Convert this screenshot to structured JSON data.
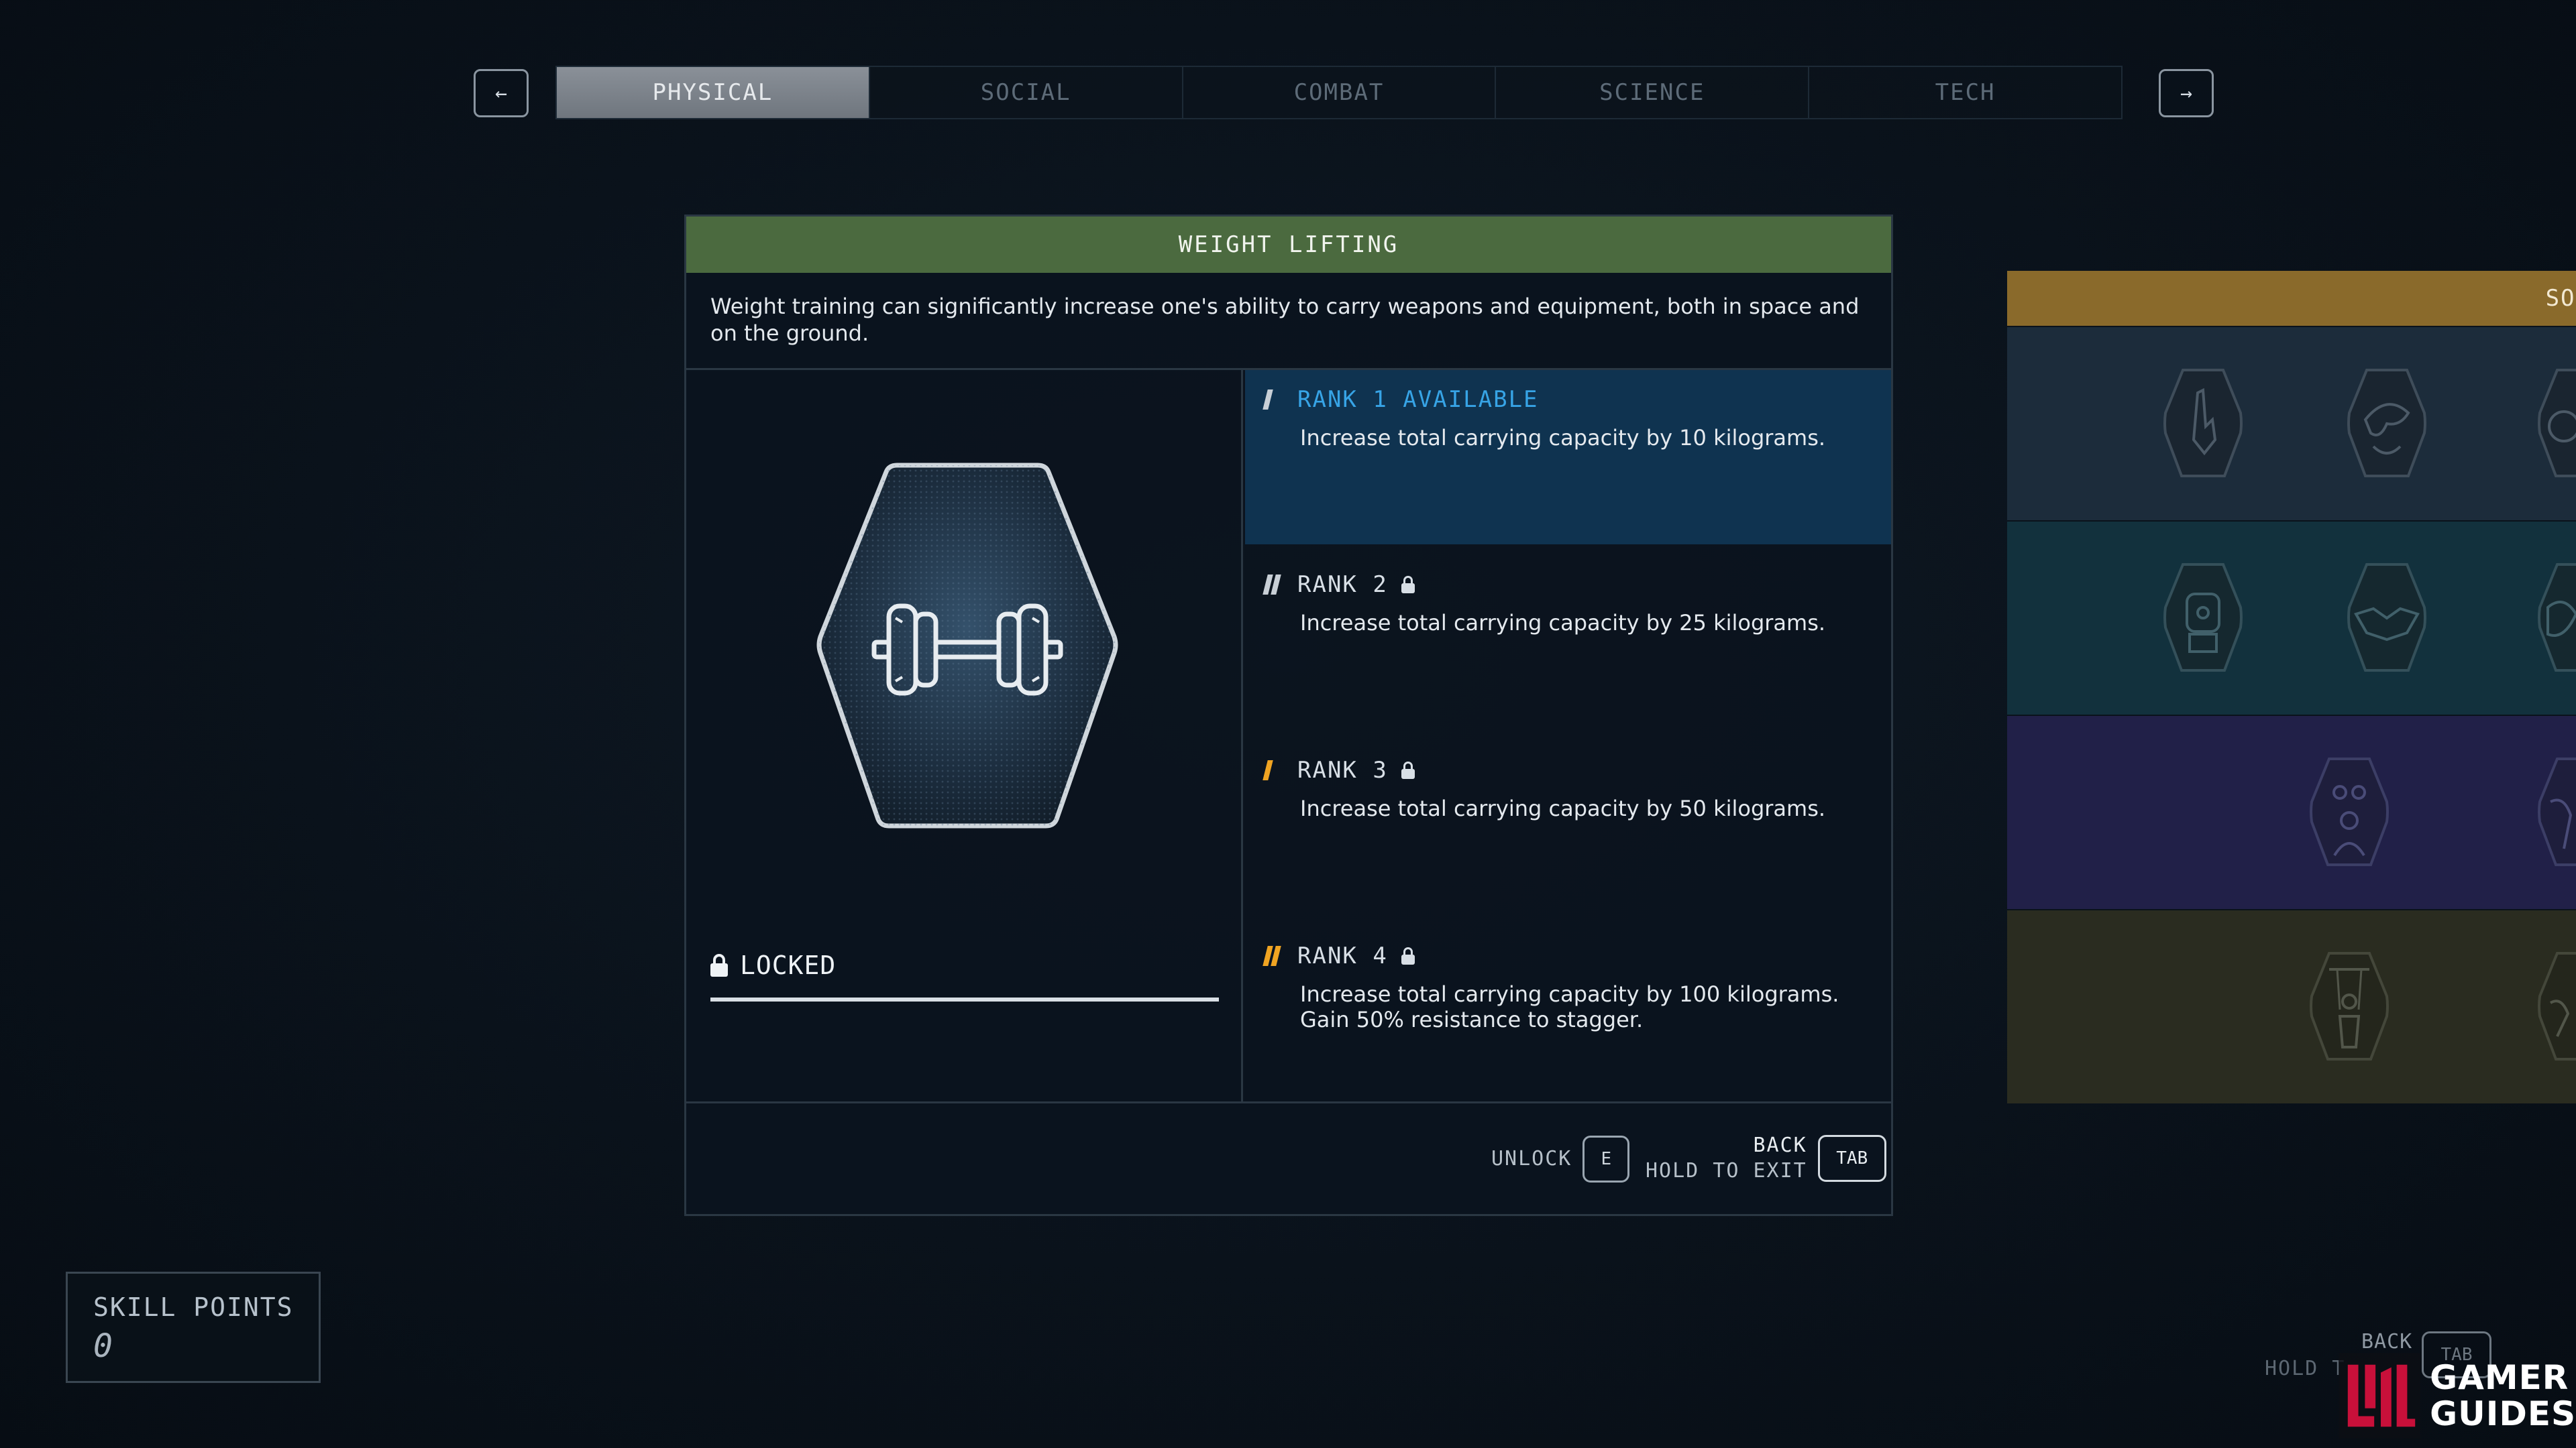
{
  "tabs": [
    {
      "label": "PHYSICAL",
      "active": true
    },
    {
      "label": "SOCIAL",
      "active": false
    },
    {
      "label": "COMBAT",
      "active": false
    },
    {
      "label": "SCIENCE",
      "active": false
    },
    {
      "label": "TECH",
      "active": false
    }
  ],
  "nav": {
    "prev_icon": "arrow-left-icon",
    "prev_glyph": "←",
    "next_icon": "arrow-right-icon",
    "next_glyph": "→"
  },
  "skill": {
    "title": "WEIGHT LIFTING",
    "description": "Weight training can significantly increase one's ability to carry weapons and equipment, both in space and on the ground.",
    "icon": "dumbbell-icon",
    "status": "LOCKED",
    "progress_fraction": 1.0
  },
  "ranks": [
    {
      "label": "RANK 1 AVAILABLE",
      "text": "Increase total carrying capacity by 10 kilograms.",
      "available": true,
      "locked": false,
      "marks": 1,
      "mark_color": "#c8cfd6"
    },
    {
      "label": "RANK 2",
      "text": "Increase total carrying capacity by 25 kilograms.",
      "available": false,
      "locked": true,
      "marks": 2,
      "mark_color": "#c8cfd6"
    },
    {
      "label": "RANK 3",
      "text": "Increase total carrying capacity by 50 kilograms.",
      "available": false,
      "locked": true,
      "marks": 1,
      "mark_color": "#f0a422"
    },
    {
      "label": "RANK 4",
      "text": "Increase total carrying capacity by 100 kilograms. Gain 50% resistance to stagger.",
      "available": false,
      "locked": true,
      "marks": 2,
      "mark_color": "#f0a422"
    }
  ],
  "footer": {
    "unlock_label": "UNLOCK",
    "unlock_key": "E",
    "back_label": "BACK",
    "exit_label": "HOLD TO EXIT",
    "back_key": "TAB"
  },
  "tree": {
    "header_label": "SOC",
    "header_color": "#8a6a2b",
    "rows": [
      {
        "icons": [
          "hand-gesture-icon",
          "tribal-mask-icon",
          "partial-portrait-icon"
        ]
      },
      {
        "icons": [
          "robot-head-icon",
          "handshake-icon",
          "snarling-face-icon"
        ]
      },
      {
        "icons": [
          "crowd-icon",
          "partial-figure-icon"
        ]
      },
      {
        "icons": [
          "puppet-icon",
          "partial-figure-icon"
        ]
      }
    ]
  },
  "skill_points": {
    "label": "SKILL POINTS",
    "value": "0"
  },
  "ghost_hints": {
    "back": "BACK",
    "hold": "HOLD T",
    "key": "TAB"
  },
  "watermark": {
    "line1": "GAMER",
    "line2": "GUIDES"
  },
  "colors": {
    "accent_blue": "#37a4e6",
    "skill_header_green": "#4b6a3f",
    "rank_available_bg": "#0f3350",
    "rank_mark_orange": "#f0a422"
  }
}
